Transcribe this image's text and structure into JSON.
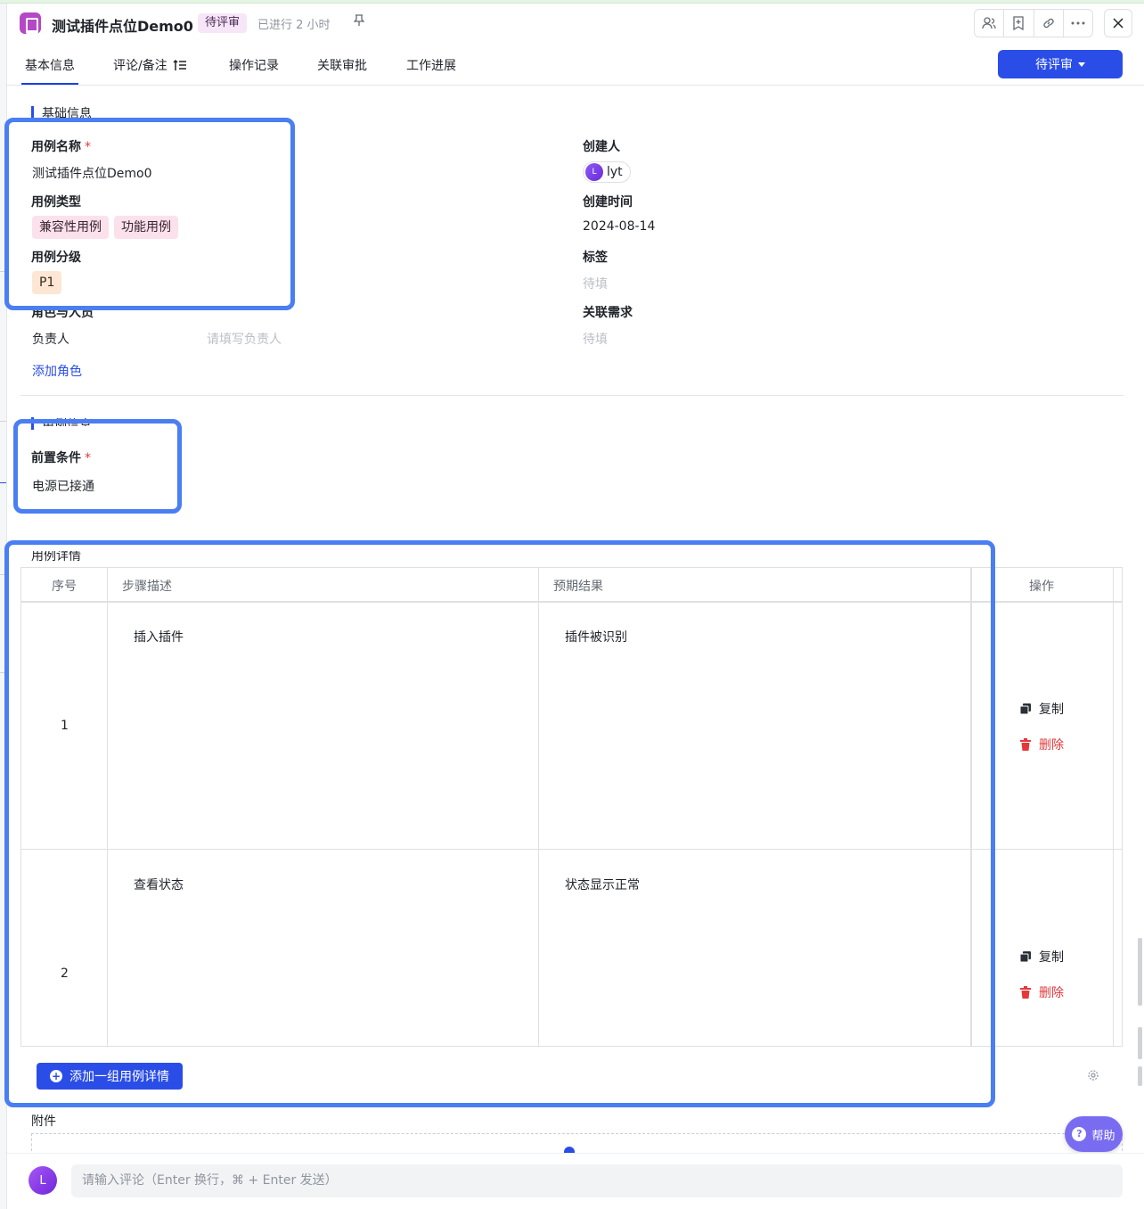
{
  "header": {
    "title": "测试插件点位Demo0",
    "status": "待评审",
    "elapsed": "已进行 2 小时"
  },
  "tabs": [
    {
      "label": "基本信息"
    },
    {
      "label": "评论/备注"
    },
    {
      "label": "操作记录"
    },
    {
      "label": "关联审批"
    },
    {
      "label": "工作进展"
    }
  ],
  "review_button": "待评审",
  "basic": {
    "section_title": "基础信息",
    "case_name_label": "用例名称",
    "required_mark": "*",
    "case_name_value": "测试插件点位Demo0",
    "case_type_label": "用例类型",
    "case_types": [
      "兼容性用例",
      "功能用例"
    ],
    "level_label": "用例分级",
    "level_value": "P1",
    "roles_label": "角色与人员",
    "owner_label": "负责人",
    "owner_placeholder": "请填写负责人",
    "add_role": "添加角色",
    "creator_label": "创建人",
    "creator_avatar": "L",
    "creator_name": "lyt",
    "created_label": "创建时间",
    "created_value": "2024-08-14",
    "tags_label": "标签",
    "tags_placeholder": "待填",
    "req_label": "关联需求",
    "req_placeholder": "待填"
  },
  "case_info": {
    "section_title": "用例信息",
    "precondition_label": "前置条件",
    "precondition_value": "电源已接通"
  },
  "details": {
    "section_title": "用例详情",
    "columns": [
      "序号",
      "步骤描述",
      "预期结果",
      "操作"
    ],
    "rows": [
      {
        "no": "1",
        "step": "插入插件",
        "expected": "插件被识别"
      },
      {
        "no": "2",
        "step": "查看状态",
        "expected": "状态显示正常"
      }
    ],
    "copy_label": "复制",
    "delete_label": "删除",
    "add_button": "添加一组用例详情"
  },
  "attachments_label": "附件",
  "help_label": "帮助",
  "comment": {
    "avatar": "L",
    "placeholder": "请输入评论（Enter 换行，⌘ + Enter 发送）"
  },
  "colors": {
    "accent": "#2a4de8",
    "highlight": "#4a7ef3",
    "danger": "#e5383b",
    "status_pill_bg": "#f7e6f8"
  }
}
